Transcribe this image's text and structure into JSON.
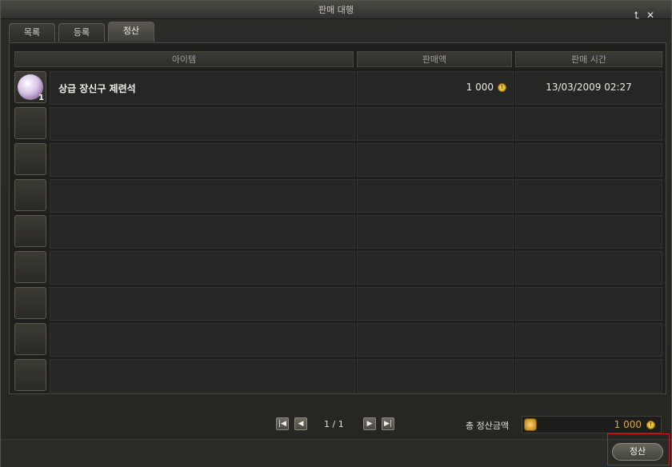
{
  "window": {
    "title": "판매 대행"
  },
  "tabs": [
    {
      "label": "목록"
    },
    {
      "label": "등록"
    },
    {
      "label": "정산",
      "active": true
    }
  ],
  "table": {
    "headers": [
      "아이템",
      "판매액",
      "판매 시간"
    ],
    "rows": [
      {
        "item_name": "상급 장신구 제련석",
        "quantity": "1",
        "price": "1 000",
        "time": "13/03/2009 02:27",
        "icon": "pearl-orb-icon"
      }
    ],
    "empty_rows": 8
  },
  "pager": {
    "text": "1 / 1"
  },
  "total": {
    "label": "총 정산금액",
    "value": "1 000"
  },
  "settle_button": {
    "label": "정산"
  },
  "colors": {
    "gold": "#d8a94a",
    "highlight": "#d01818"
  }
}
